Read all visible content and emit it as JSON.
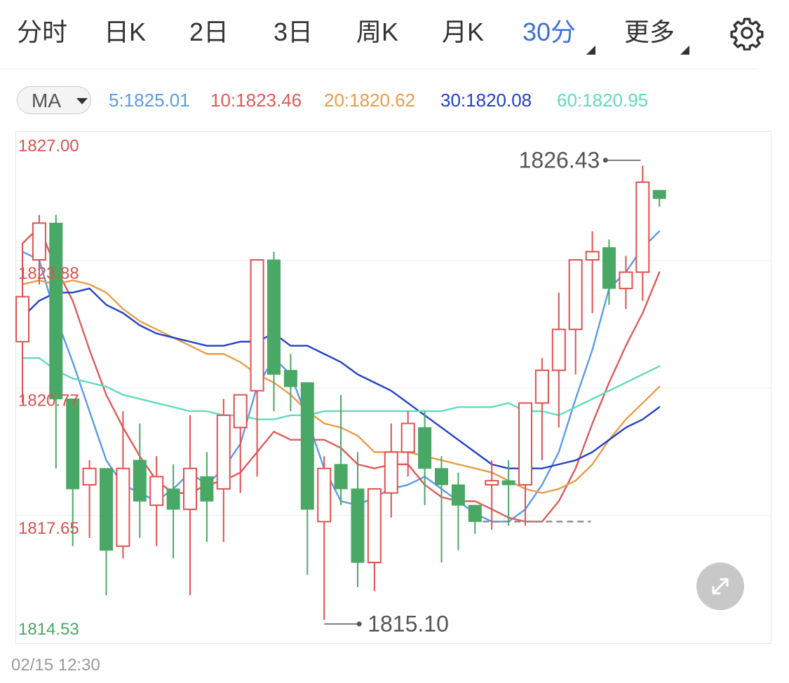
{
  "tabs": {
    "items": [
      "分时",
      "日K",
      "2日",
      "3日",
      "周K",
      "月K",
      "30分",
      "更多"
    ],
    "active_index": 6
  },
  "settings_icon": "gear-icon",
  "indicator": {
    "selected": "MA",
    "values": [
      {
        "label": "5:1825.01",
        "color": "#5b9be6"
      },
      {
        "label": "10:1823.46",
        "color": "#e05a5a"
      },
      {
        "label": "20:1820.62",
        "color": "#ea9c45"
      },
      {
        "label": "30:1820.08",
        "color": "#2240c8"
      },
      {
        "label": "60:1820.95",
        "color": "#5fdcba"
      }
    ]
  },
  "colors": {
    "up": "#e05050",
    "down": "#4aa866",
    "price_label_up": "#d9534f",
    "price_label_down": "#4aa866"
  },
  "chart_data": {
    "type": "candlestick",
    "y_ticks": [
      "1827.00",
      "1823.88",
      "1820.77",
      "1817.65",
      "1814.53"
    ],
    "ylim": [
      1814.53,
      1827.0
    ],
    "high_label": "1826.43",
    "low_label": "1815.10",
    "candles": [
      {
        "o": 1821.9,
        "h": 1824.3,
        "l": 1820.4,
        "c": 1823.0
      },
      {
        "o": 1823.9,
        "h": 1825.0,
        "l": 1823.3,
        "c": 1824.8
      },
      {
        "o": 1824.8,
        "h": 1825.0,
        "l": 1818.8,
        "c": 1820.5
      },
      {
        "o": 1820.5,
        "h": 1820.5,
        "l": 1816.9,
        "c": 1818.3
      },
      {
        "o": 1818.4,
        "h": 1819.0,
        "l": 1817.1,
        "c": 1818.8
      },
      {
        "o": 1818.8,
        "h": 1818.8,
        "l": 1815.7,
        "c": 1816.8
      },
      {
        "o": 1816.9,
        "h": 1820.2,
        "l": 1816.6,
        "c": 1818.8
      },
      {
        "o": 1819.0,
        "h": 1819.9,
        "l": 1817.1,
        "c": 1818.0
      },
      {
        "o": 1817.9,
        "h": 1819.1,
        "l": 1816.9,
        "c": 1818.6
      },
      {
        "o": 1818.3,
        "h": 1818.9,
        "l": 1816.6,
        "c": 1817.8
      },
      {
        "o": 1817.8,
        "h": 1820.1,
        "l": 1815.7,
        "c": 1818.8
      },
      {
        "o": 1818.6,
        "h": 1819.2,
        "l": 1817.0,
        "c": 1818.0
      },
      {
        "o": 1818.3,
        "h": 1820.5,
        "l": 1817.0,
        "c": 1820.1
      },
      {
        "o": 1819.8,
        "h": 1820.5,
        "l": 1818.2,
        "c": 1820.6
      },
      {
        "o": 1820.7,
        "h": 1823.2,
        "l": 1818.6,
        "c": 1823.9
      },
      {
        "o": 1823.9,
        "h": 1824.1,
        "l": 1820.2,
        "c": 1821.1
      },
      {
        "o": 1821.2,
        "h": 1821.6,
        "l": 1820.2,
        "c": 1820.8
      },
      {
        "o": 1820.9,
        "h": 1820.9,
        "l": 1816.2,
        "c": 1817.8
      },
      {
        "o": 1817.5,
        "h": 1819.1,
        "l": 1815.1,
        "c": 1818.8
      },
      {
        "o": 1818.9,
        "h": 1820.6,
        "l": 1817.9,
        "c": 1818.3
      },
      {
        "o": 1818.3,
        "h": 1819.2,
        "l": 1815.9,
        "c": 1816.5
      },
      {
        "o": 1816.5,
        "h": 1818.2,
        "l": 1815.8,
        "c": 1818.3
      },
      {
        "o": 1818.2,
        "h": 1819.9,
        "l": 1817.6,
        "c": 1819.2
      },
      {
        "o": 1819.2,
        "h": 1820.2,
        "l": 1818.6,
        "c": 1819.9
      },
      {
        "o": 1819.8,
        "h": 1820.2,
        "l": 1817.9,
        "c": 1818.8
      },
      {
        "o": 1818.8,
        "h": 1819.1,
        "l": 1816.5,
        "c": 1818.4
      },
      {
        "o": 1818.4,
        "h": 1818.7,
        "l": 1816.8,
        "c": 1817.9
      },
      {
        "o": 1817.9,
        "h": 1817.9,
        "l": 1817.2,
        "c": 1817.5
      },
      {
        "o": 1818.4,
        "h": 1819.0,
        "l": 1817.3,
        "c": 1818.5
      },
      {
        "o": 1818.5,
        "h": 1819.0,
        "l": 1817.4,
        "c": 1818.4
      },
      {
        "o": 1818.4,
        "h": 1820.2,
        "l": 1817.4,
        "c": 1820.4
      },
      {
        "o": 1820.4,
        "h": 1821.5,
        "l": 1819.0,
        "c": 1821.2
      },
      {
        "o": 1821.2,
        "h": 1823.1,
        "l": 1819.8,
        "c": 1822.2
      },
      {
        "o": 1822.2,
        "h": 1823.6,
        "l": 1821.1,
        "c": 1823.9
      },
      {
        "o": 1823.9,
        "h": 1824.6,
        "l": 1822.6,
        "c": 1824.1
      },
      {
        "o": 1824.2,
        "h": 1824.4,
        "l": 1822.8,
        "c": 1823.2
      },
      {
        "o": 1823.2,
        "h": 1824.0,
        "l": 1822.7,
        "c": 1823.6
      },
      {
        "o": 1823.6,
        "h": 1826.2,
        "l": 1822.9,
        "c": 1825.8
      },
      {
        "o": 1825.6,
        "h": 1825.6,
        "l": 1825.2,
        "c": 1825.4
      }
    ],
    "ma_series": [
      {
        "name": "5",
        "color": "#5b9be6",
        "values": [
          1824.1,
          1823.9,
          1822.5,
          1821.4,
          1820.2,
          1819.0,
          1818.4,
          1818.2,
          1818.0,
          1818.3,
          1818.7,
          1818.4,
          1818.8,
          1819.4,
          1820.8,
          1821.5,
          1821.1,
          1820.0,
          1818.8,
          1818.0,
          1817.9,
          1818.1,
          1818.3,
          1818.4,
          1818.6,
          1818.3,
          1818.0,
          1817.7,
          1817.5,
          1817.5,
          1817.8,
          1818.4,
          1819.2,
          1820.5,
          1821.7,
          1823.2,
          1823.6,
          1824.2,
          1824.6
        ]
      },
      {
        "name": "10",
        "color": "#e05a5a",
        "values": [
          1824.3,
          1824.7,
          1823.7,
          1822.9,
          1821.7,
          1820.6,
          1819.8,
          1819.1,
          1818.5,
          1818.2,
          1818.2,
          1818.4,
          1818.5,
          1818.7,
          1819.2,
          1819.7,
          1819.5,
          1819.5,
          1819.5,
          1819.3,
          1818.9,
          1818.8,
          1818.9,
          1818.9,
          1818.4,
          1818.1,
          1818.0,
          1818.0,
          1817.8,
          1817.6,
          1817.5,
          1817.5,
          1818.0,
          1818.8,
          1819.9,
          1820.9,
          1821.8,
          1822.6,
          1823.6
        ]
      },
      {
        "name": "20",
        "color": "#ea9c45",
        "values": [
          1823.3,
          1823.4,
          1823.3,
          1823.4,
          1823.3,
          1823.1,
          1822.7,
          1822.4,
          1822.2,
          1822.0,
          1821.8,
          1821.6,
          1821.6,
          1821.4,
          1821.1,
          1820.9,
          1820.6,
          1820.2,
          1819.9,
          1819.8,
          1819.6,
          1819.2,
          1819.2,
          1819.2,
          1819.1,
          1819.0,
          1818.9,
          1818.8,
          1818.7,
          1818.5,
          1818.3,
          1818.2,
          1818.3,
          1818.5,
          1818.9,
          1819.5,
          1820.0,
          1820.4,
          1820.8
        ]
      },
      {
        "name": "30",
        "color": "#2240c8",
        "values": [
          1822.5,
          1822.9,
          1823.1,
          1823.1,
          1823.2,
          1822.8,
          1822.6,
          1822.3,
          1822.1,
          1822.0,
          1821.9,
          1821.8,
          1821.8,
          1821.9,
          1821.9,
          1822.1,
          1821.8,
          1821.8,
          1821.6,
          1821.4,
          1821.1,
          1820.9,
          1820.7,
          1820.4,
          1820.1,
          1819.8,
          1819.5,
          1819.2,
          1818.9,
          1818.8,
          1818.8,
          1818.8,
          1818.9,
          1819.0,
          1819.2,
          1819.5,
          1819.8,
          1820.0,
          1820.3
        ]
      },
      {
        "name": "60",
        "color": "#5fdcba",
        "values": [
          1821.5,
          1821.5,
          1821.2,
          1821.0,
          1820.9,
          1820.8,
          1820.6,
          1820.5,
          1820.4,
          1820.3,
          1820.2,
          1820.2,
          1820.1,
          1820.1,
          1820.0,
          1820.0,
          1820.1,
          1820.1,
          1820.2,
          1820.2,
          1820.2,
          1820.2,
          1820.2,
          1820.2,
          1820.2,
          1820.2,
          1820.3,
          1820.3,
          1820.3,
          1820.4,
          1820.2,
          1820.2,
          1820.1,
          1820.3,
          1820.5,
          1820.7,
          1820.9,
          1821.1,
          1821.3
        ]
      }
    ]
  },
  "footer": {
    "datetime": "02/15 12:30"
  },
  "expand_icon": "expand-icon"
}
